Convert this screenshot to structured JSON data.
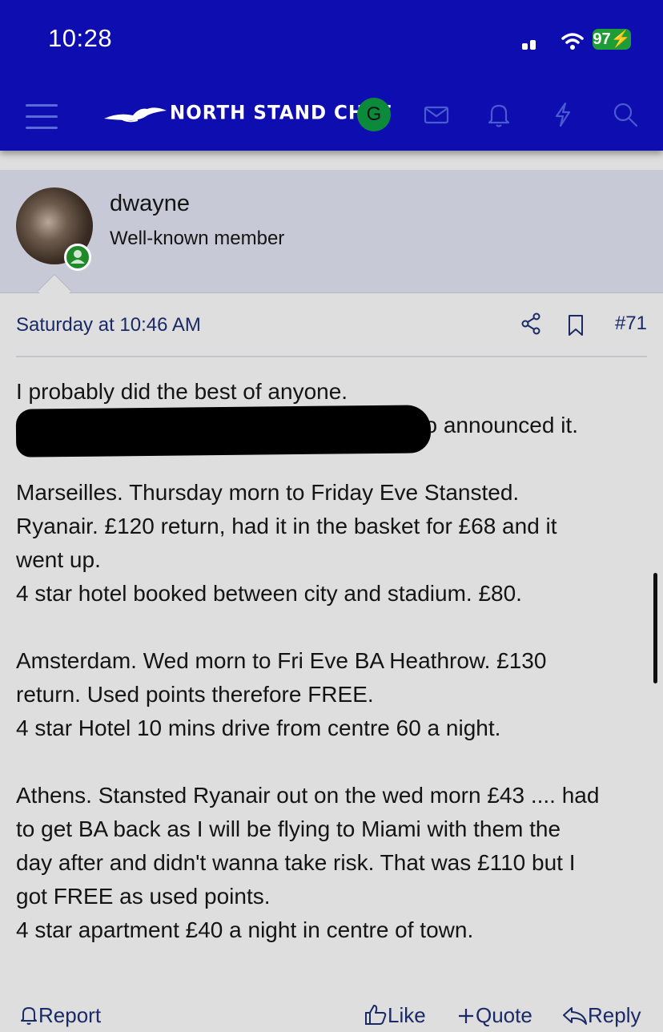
{
  "status_bar": {
    "time": "10:28",
    "battery": "97"
  },
  "header": {
    "site_name": "NORTH STAND CHAT",
    "user_initial": "G"
  },
  "post": {
    "username": "dwayne",
    "user_title": "Well-known member",
    "date": "Saturday at 10:46 AM",
    "number": "#71",
    "paragraphs": [
      [
        "I probably did the best of anyone.",
        "",
        "I was straight on the draw when the journo announced it."
      ],
      [
        "Marseilles. Thursday morn to Friday Eve Stansted.",
        "Ryanair. £120 return, had it in the basket for £68 and it",
        "went up.",
        "4 star hotel booked between city and stadium. £80."
      ],
      [
        "Amsterdam. Wed morn to Fri Eve BA Heathrow. £130",
        "return. Used points therefore FREE.",
        "4 star Hotel 10 mins drive from centre 60 a night."
      ],
      [
        "Athens. Stansted Ryanair out on the wed morn £43 .... had",
        "to get BA back as I will be flying to Miami with them the",
        "day after and didn't wanna take risk. That was £110 but I",
        "got FREE as used points.",
        "4 star apartment £40 a night in centre of town."
      ]
    ]
  },
  "actions": {
    "report": "Report",
    "like": "Like",
    "quote": "Quote",
    "reply": "Reply"
  },
  "colors": {
    "brand_blue": "#0d0db0",
    "link_navy": "#1a2a66",
    "online_green": "#1f8a2a",
    "battery_green": "#1e9d36"
  },
  "icons": [
    "menu-icon",
    "seagull-logo-icon",
    "mail-icon",
    "bell-icon",
    "lightning-icon",
    "search-icon",
    "share-icon",
    "bookmark-icon",
    "report-bell-icon",
    "thumbs-up-icon",
    "plus-icon",
    "reply-arrow-icon"
  ]
}
